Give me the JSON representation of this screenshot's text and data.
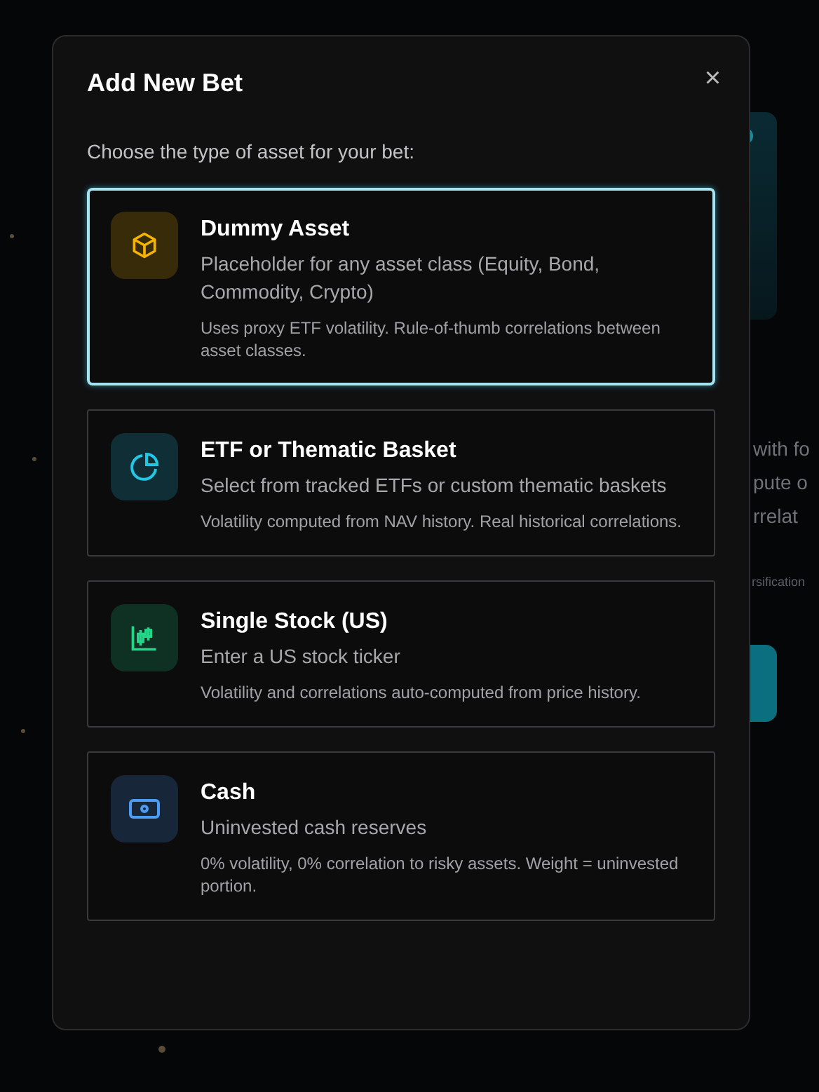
{
  "background": {
    "texts": [
      {
        "text": "with fo"
      },
      {
        "text": "pute o"
      },
      {
        "text": "rrelat"
      }
    ],
    "note": "rsification"
  },
  "dialog": {
    "title": "Add New Bet",
    "close": "×",
    "prompt": "Choose the type of asset for your bet:",
    "options": [
      {
        "kind": "cube",
        "color": "#f5b400",
        "title": "Dummy Asset",
        "description": "Placeholder for any asset class (Equity, Bond, Commodity, Crypto)",
        "note": "Uses proxy ETF volatility. Rule-of-thumb correlations between asset classes.",
        "selected": true
      },
      {
        "kind": "pie",
        "color": "#22c7e6",
        "title": "ETF or Thematic Basket",
        "description": "Select from tracked ETFs or custom thematic baskets",
        "note": "Volatility computed from NAV history. Real historical correlations.",
        "selected": false
      },
      {
        "kind": "candles",
        "color": "#22d68a",
        "title": "Single Stock (US)",
        "description": "Enter a US stock ticker",
        "note": "Volatility and correlations auto-computed from price history.",
        "selected": false
      },
      {
        "kind": "cash",
        "color": "#4a9cf5",
        "title": "Cash",
        "description": "Uninvested cash reserves",
        "note": "0% volatility, 0% correlation to risky assets. Weight = uninvested portion.",
        "selected": false
      }
    ]
  }
}
